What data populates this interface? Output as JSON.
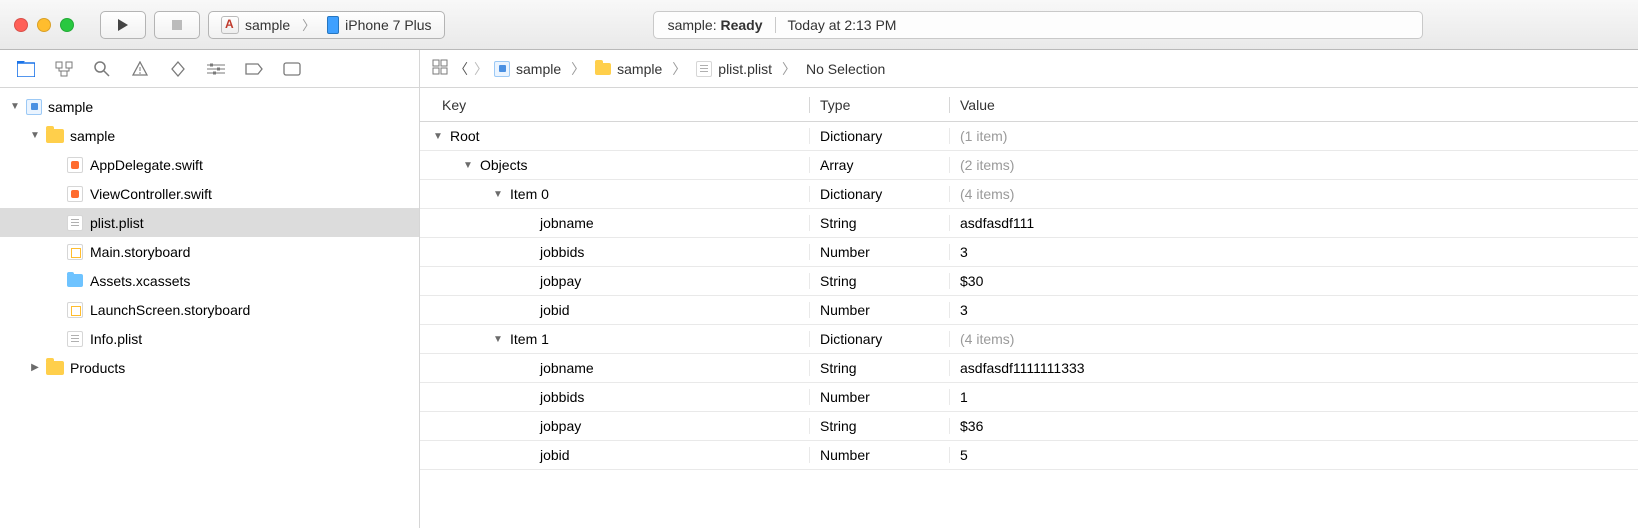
{
  "toolbar": {
    "scheme_target": "sample",
    "scheme_device": "iPhone 7 Plus",
    "activity_prefix": "sample:",
    "activity_status": "Ready",
    "activity_time": "Today at 2:13 PM"
  },
  "jumpbar": {
    "items": [
      "sample",
      "sample",
      "plist.plist",
      "No Selection"
    ]
  },
  "navigator": {
    "root": "sample",
    "group": "sample",
    "files": [
      {
        "name": "AppDelegate.swift",
        "icon": "swift"
      },
      {
        "name": "ViewController.swift",
        "icon": "swift"
      },
      {
        "name": "plist.plist",
        "icon": "plist",
        "selected": true
      },
      {
        "name": "Main.storyboard",
        "icon": "storyboard"
      },
      {
        "name": "Assets.xcassets",
        "icon": "assets"
      },
      {
        "name": "LaunchScreen.storyboard",
        "icon": "storyboard"
      },
      {
        "name": "Info.plist",
        "icon": "plist"
      }
    ],
    "products": "Products"
  },
  "plist": {
    "columns": {
      "key": "Key",
      "type": "Type",
      "value": "Value"
    },
    "rows": [
      {
        "indent": 0,
        "disclosure": "▼",
        "key": "Root",
        "type": "Dictionary",
        "value": "(1 item)",
        "dim": true
      },
      {
        "indent": 1,
        "disclosure": "▼",
        "key": "Objects",
        "type": "Array",
        "value": "(2 items)",
        "dim": true
      },
      {
        "indent": 2,
        "disclosure": "▼",
        "key": "Item 0",
        "type": "Dictionary",
        "value": "(4 items)",
        "dim": true
      },
      {
        "indent": 3,
        "disclosure": "",
        "key": "jobname",
        "type": "String",
        "value": "asdfasdf111"
      },
      {
        "indent": 3,
        "disclosure": "",
        "key": "jobbids",
        "type": "Number",
        "value": "3"
      },
      {
        "indent": 3,
        "disclosure": "",
        "key": "jobpay",
        "type": "String",
        "value": "$30"
      },
      {
        "indent": 3,
        "disclosure": "",
        "key": "jobid",
        "type": "Number",
        "value": "3"
      },
      {
        "indent": 2,
        "disclosure": "▼",
        "key": "Item 1",
        "type": "Dictionary",
        "value": "(4 items)",
        "dim": true
      },
      {
        "indent": 3,
        "disclosure": "",
        "key": "jobname",
        "type": "String",
        "value": "asdfasdf1111111333"
      },
      {
        "indent": 3,
        "disclosure": "",
        "key": "jobbids",
        "type": "Number",
        "value": "1"
      },
      {
        "indent": 3,
        "disclosure": "",
        "key": "jobpay",
        "type": "String",
        "value": "$36"
      },
      {
        "indent": 3,
        "disclosure": "",
        "key": "jobid",
        "type": "Number",
        "value": "5"
      }
    ]
  }
}
